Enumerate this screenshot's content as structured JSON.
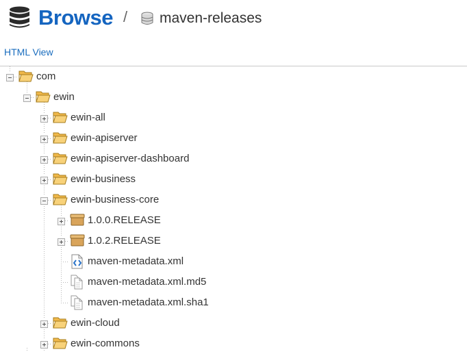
{
  "header": {
    "title": "Browse",
    "separator": "/",
    "repository": "maven-releases"
  },
  "view_link": "HTML View",
  "tree": [
    {
      "label": "com",
      "level": 0,
      "type": "folder",
      "expander": "minus"
    },
    {
      "label": "ewin",
      "level": 1,
      "type": "folder",
      "expander": "minus"
    },
    {
      "label": "ewin-all",
      "level": 2,
      "type": "folder",
      "expander": "plus"
    },
    {
      "label": "ewin-apiserver",
      "level": 2,
      "type": "folder",
      "expander": "plus"
    },
    {
      "label": "ewin-apiserver-dashboard",
      "level": 2,
      "type": "folder",
      "expander": "plus"
    },
    {
      "label": "ewin-business",
      "level": 2,
      "type": "folder",
      "expander": "plus"
    },
    {
      "label": "ewin-business-core",
      "level": 2,
      "type": "folder",
      "expander": "minus"
    },
    {
      "label": "1.0.0.RELEASE",
      "level": 3,
      "type": "package",
      "expander": "plus"
    },
    {
      "label": "1.0.2.RELEASE",
      "level": 3,
      "type": "package",
      "expander": "plus"
    },
    {
      "label": "maven-metadata.xml",
      "level": 3,
      "type": "xml",
      "expander": "none"
    },
    {
      "label": "maven-metadata.xml.md5",
      "level": 3,
      "type": "file",
      "expander": "none"
    },
    {
      "label": "maven-metadata.xml.sha1",
      "level": 3,
      "type": "file",
      "expander": "none"
    },
    {
      "label": "ewin-cloud",
      "level": 2,
      "type": "folder",
      "expander": "plus"
    },
    {
      "label": "ewin-commons",
      "level": 2,
      "type": "folder",
      "expander": "plus"
    }
  ],
  "icons": {
    "header": "database-icon",
    "repository": "repository-icon",
    "folder": "folder-open-icon",
    "package": "package-icon",
    "xml": "xml-file-icon",
    "file": "file-icon"
  },
  "colors": {
    "title": "#1565c0",
    "link": "#1a6dbe",
    "folder": "#f5c765",
    "package": "#d9a45a",
    "tree_line": "#b5b5b5"
  }
}
